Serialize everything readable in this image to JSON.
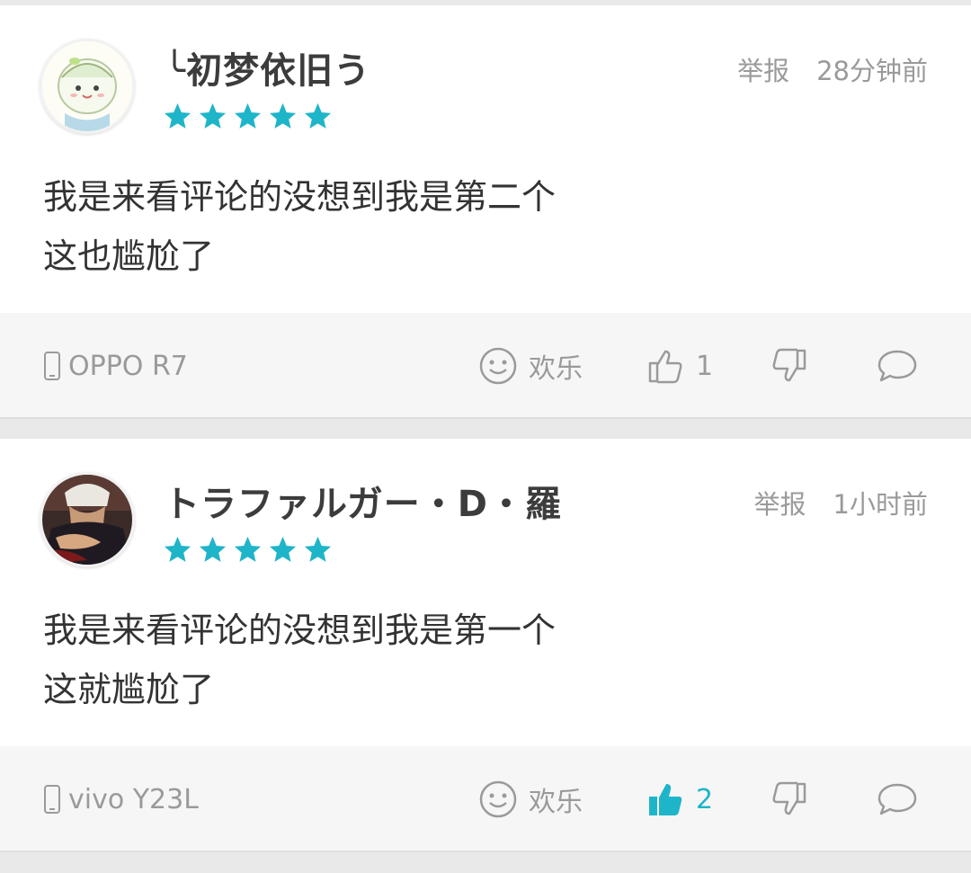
{
  "colors": {
    "accent": "#1fb5c9",
    "star": "#1fb5c9",
    "muted": "#9a9a9a",
    "text": "#333333"
  },
  "comments": [
    {
      "username": "╰初梦依旧う",
      "rating": 5,
      "report_label": "举报",
      "time": "28分钟前",
      "content_lines": [
        "我是来看评论的没想到我是第二个",
        "这也尴尬了"
      ],
      "device_icon": "phone-icon",
      "device": "OPPO R7",
      "mood_icon": "smiley-icon",
      "mood_label": "欢乐",
      "like_count": "1",
      "liked": false
    },
    {
      "username": "トラファルガー・D・羅",
      "rating": 5,
      "report_label": "举报",
      "time": "1小时前",
      "content_lines": [
        "我是来看评论的没想到我是第一个",
        "这就尴尬了"
      ],
      "device_icon": "phone-icon",
      "device": "vivo Y23L",
      "mood_icon": "smiley-icon",
      "mood_label": "欢乐",
      "like_count": "2",
      "liked": true
    }
  ]
}
